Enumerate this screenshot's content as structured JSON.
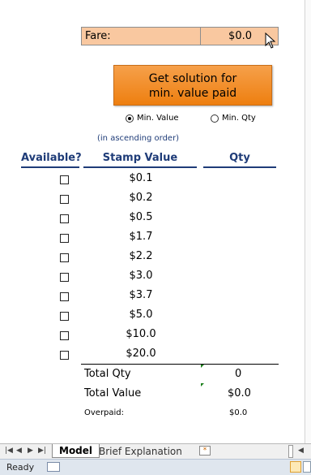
{
  "fare": {
    "label": "Fare:",
    "value": "$0.0"
  },
  "solve_button": {
    "line1": "Get solution for",
    "line2": "min. value paid"
  },
  "options": [
    {
      "label": "Min. Value",
      "selected": true
    },
    {
      "label": "Min. Qty",
      "selected": false
    }
  ],
  "order_note": "(in ascending order)",
  "headers": {
    "available": "Available?",
    "stamp_value": "Stamp Value",
    "qty": "Qty"
  },
  "stamps": [
    "$0.1",
    "$0.2",
    "$0.5",
    "$1.7",
    "$2.2",
    "$3.0",
    "$3.7",
    "$5.0",
    "$10.0",
    "$20.0"
  ],
  "totals": {
    "total_qty_label": "Total Qty",
    "total_qty_value": "0",
    "total_value_label": "Total Value",
    "total_value_value": "$0.0",
    "overpaid_label": "Overpaid:",
    "overpaid_value": "$0.0"
  },
  "sheet_tabs": [
    "Model",
    "Brief Explanation"
  ],
  "status": "Ready",
  "colors": {
    "accent_blue": "#1f3c78",
    "button_orange": "#ee7f10",
    "fare_fill": "#f9c8a0"
  }
}
